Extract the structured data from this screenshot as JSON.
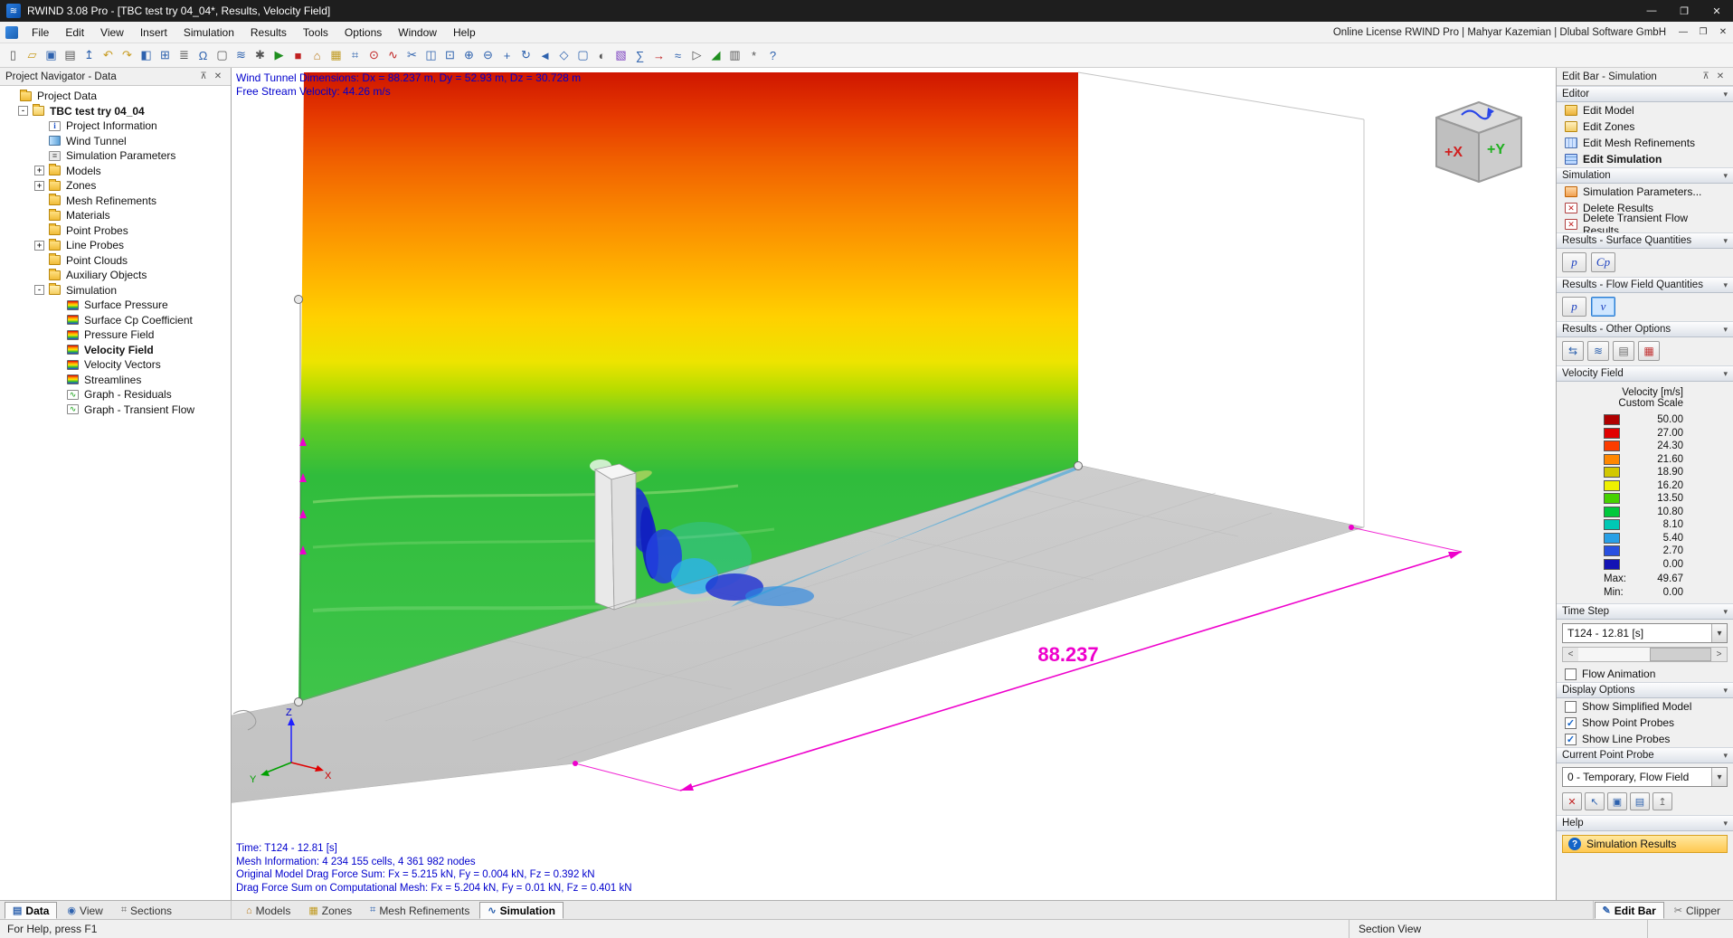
{
  "window": {
    "title": "RWIND 3.08 Pro - [TBC test try 04_04*, Results, Velocity Field]",
    "minimize": "—",
    "maximize": "❐",
    "close": "✕"
  },
  "menubar": {
    "items": [
      "File",
      "Edit",
      "View",
      "Insert",
      "Simulation",
      "Results",
      "Tools",
      "Options",
      "Window",
      "Help"
    ],
    "license": "Online License RWIND Pro | Mahyar Kazemian | Dlubal Software GmbH",
    "mdi": {
      "minimize": "—",
      "restore": "❐",
      "close": "✕"
    }
  },
  "toolbar": {
    "icons": [
      {
        "name": "new-file-icon",
        "g": "▯",
        "c": "#555555"
      },
      {
        "name": "open-icon",
        "g": "▱",
        "c": "#c79a1e"
      },
      {
        "name": "save-icon",
        "g": "▣",
        "c": "#2e62ae"
      },
      {
        "name": "print-icon",
        "g": "▤",
        "c": "#555555"
      },
      {
        "name": "export-icon",
        "g": "↥",
        "c": "#2e62ae"
      },
      {
        "name": "undo-icon",
        "g": "↶",
        "c": "#c79a1e"
      },
      {
        "name": "redo-icon",
        "g": "↷",
        "c": "#c79a1e"
      },
      {
        "name": "navigator-icon",
        "g": "◧",
        "c": "#2e62ae"
      },
      {
        "name": "tables-icon",
        "g": "⊞",
        "c": "#2e62ae"
      },
      {
        "name": "properties-icon",
        "g": "≣",
        "c": "#555555"
      },
      {
        "name": "units-icon",
        "g": "Ω",
        "c": "#2e62ae"
      },
      {
        "name": "comment-icon",
        "g": "▢",
        "c": "#555555"
      },
      {
        "name": "wind-tunnel-icon",
        "g": "≋",
        "c": "#2e62ae"
      },
      {
        "name": "simulation-parameters-icon",
        "g": "✱",
        "c": "#555555"
      },
      {
        "name": "start-simulation-icon",
        "g": "▶",
        "c": "#1f8f1f"
      },
      {
        "name": "stop-simulation-icon",
        "g": "■",
        "c": "#c02020"
      },
      {
        "name": "models-icon",
        "g": "⌂",
        "c": "#b87818"
      },
      {
        "name": "zones-icon",
        "g": "▦",
        "c": "#c09a20"
      },
      {
        "name": "mesh-icon",
        "g": "⌗",
        "c": "#2e62ae"
      },
      {
        "name": "point-probe-icon",
        "g": "⊙",
        "c": "#c02020"
      },
      {
        "name": "line-probe-icon",
        "g": "∿",
        "c": "#c02020"
      },
      {
        "name": "clipper-icon",
        "g": "✂",
        "c": "#2e62ae"
      },
      {
        "name": "section-icon",
        "g": "◫",
        "c": "#2e62ae"
      },
      {
        "name": "zoom-window-icon",
        "g": "⊡",
        "c": "#2e62ae"
      },
      {
        "name": "zoom-in-icon",
        "g": "⊕",
        "c": "#2e62ae"
      },
      {
        "name": "zoom-out-icon",
        "g": "⊖",
        "c": "#2e62ae"
      },
      {
        "name": "pan-icon",
        "g": "+",
        "c": "#2e62ae"
      },
      {
        "name": "rotate-view-icon",
        "g": "↻",
        "c": "#2e62ae"
      },
      {
        "name": "previous-view-icon",
        "g": "◄",
        "c": "#2e62ae"
      },
      {
        "name": "isometric-view-icon",
        "g": "◇",
        "c": "#2e62ae"
      },
      {
        "name": "views-icon",
        "g": "▢",
        "c": "#2e62ae"
      },
      {
        "name": "render-mode-icon",
        "g": "◐",
        "c": "#555555"
      },
      {
        "name": "color-scale-icon",
        "g": "▧",
        "c": "#7a3fbf"
      },
      {
        "name": "result-values-icon",
        "g": "∑",
        "c": "#2e62ae"
      },
      {
        "name": "vectors-icon",
        "g": "→",
        "c": "#c02020"
      },
      {
        "name": "streamlines-icon",
        "g": "≈",
        "c": "#2e62ae"
      },
      {
        "name": "animation-icon",
        "g": "▷",
        "c": "#555555"
      },
      {
        "name": "graph-icon",
        "g": "◢",
        "c": "#1f8f1f"
      },
      {
        "name": "report-icon",
        "g": "▥",
        "c": "#555555"
      },
      {
        "name": "settings-icon",
        "g": "*",
        "c": "#555555"
      },
      {
        "name": "help-icon",
        "g": "?",
        "c": "#2e62ae"
      }
    ]
  },
  "navigator": {
    "title": "Project Navigator - Data",
    "pin": "⊼",
    "close": "✕",
    "items": [
      {
        "label": "Project Data",
        "lvl": 0,
        "icon": "folder",
        "exp": "",
        "st": ""
      },
      {
        "label": "TBC test try 04_04",
        "lvl": 1,
        "icon": "folder-open",
        "exp": "-",
        "st": "bold"
      },
      {
        "label": "Project Information",
        "lvl": 2,
        "icon": "doc",
        "exp": "",
        "st": ""
      },
      {
        "label": "Wind Tunnel",
        "lvl": 2,
        "icon": "tunnel",
        "exp": "",
        "st": ""
      },
      {
        "label": "Simulation Parameters",
        "lvl": 2,
        "icon": "params",
        "exp": "",
        "st": ""
      },
      {
        "label": "Models",
        "lvl": 2,
        "icon": "folder",
        "exp": "+",
        "st": ""
      },
      {
        "label": "Zones",
        "lvl": 2,
        "icon": "folder",
        "exp": "+",
        "st": ""
      },
      {
        "label": "Mesh Refinements",
        "lvl": 2,
        "icon": "folder",
        "exp": "",
        "st": ""
      },
      {
        "label": "Materials",
        "lvl": 2,
        "icon": "folder",
        "exp": "",
        "st": ""
      },
      {
        "label": "Point Probes",
        "lvl": 2,
        "icon": "folder",
        "exp": "",
        "st": ""
      },
      {
        "label": "Line Probes",
        "lvl": 2,
        "icon": "folder",
        "exp": "+",
        "st": ""
      },
      {
        "label": "Point Clouds",
        "lvl": 2,
        "icon": "folder",
        "exp": "",
        "st": ""
      },
      {
        "label": "Auxiliary Objects",
        "lvl": 2,
        "icon": "folder",
        "exp": "",
        "st": ""
      },
      {
        "label": "Simulation",
        "lvl": 2,
        "icon": "folder-open",
        "exp": "-",
        "st": ""
      },
      {
        "label": "Surface Pressure",
        "lvl": 3,
        "icon": "result",
        "exp": "",
        "st": ""
      },
      {
        "label": "Surface Cp Coefficient",
        "lvl": 3,
        "icon": "result",
        "exp": "",
        "st": ""
      },
      {
        "label": "Pressure Field",
        "lvl": 3,
        "icon": "result",
        "exp": "",
        "st": ""
      },
      {
        "label": "Velocity Field",
        "lvl": 3,
        "icon": "result",
        "exp": "",
        "st": "bold"
      },
      {
        "label": "Velocity Vectors",
        "lvl": 3,
        "icon": "result",
        "exp": "",
        "st": ""
      },
      {
        "label": "Streamlines",
        "lvl": 3,
        "icon": "result",
        "exp": "",
        "st": ""
      },
      {
        "label": "Graph - Residuals",
        "lvl": 3,
        "icon": "graph",
        "exp": "",
        "st": ""
      },
      {
        "label": "Graph - Transient Flow",
        "lvl": 3,
        "icon": "graph",
        "exp": "",
        "st": ""
      }
    ]
  },
  "viewport": {
    "info_top": [
      "Wind Tunnel Dimensions: Dx = 88.237 m, Dy = 52.93 m, Dz = 30.728 m",
      "Free Stream Velocity: 44.26 m/s"
    ],
    "info_bottom": [
      "Time: T124 - 12.81 [s]",
      "Mesh Information: 4 234 155 cells, 4 361 982 nodes",
      "Original Model Drag Force Sum: Fx = 5.215 kN, Fy = 0.004 kN, Fz = 0.392 kN",
      "Drag Force Sum on Computational Mesh: Fx = 5.204 kN, Fy = 0.01 kN, Fz = 0.401 kN"
    ],
    "dimension_label": "88.237",
    "nav_cube": {
      "x": "+X",
      "y": "+Y"
    },
    "axes": {
      "x": "X",
      "y": "Y",
      "z": "Z"
    }
  },
  "editbar": {
    "title": "Edit Bar - Simulation",
    "pin": "⊼",
    "close": "✕",
    "collapse": "▾",
    "dropdown": "▾",
    "editor": {
      "header": "Editor",
      "items": [
        {
          "label": "Edit Model",
          "icon": "edit-model",
          "st": ""
        },
        {
          "label": "Edit Zones",
          "icon": "edit-zones",
          "st": ""
        },
        {
          "label": "Edit Mesh Refinements",
          "icon": "edit-mesh",
          "st": ""
        },
        {
          "label": "Edit Simulation",
          "icon": "edit-simulation",
          "st": "bold"
        }
      ]
    },
    "simulation": {
      "header": "Simulation",
      "items": [
        {
          "label": "Simulation Parameters...",
          "icon": "sim-params",
          "st": ""
        },
        {
          "label": "Delete Results",
          "icon": "delete-results",
          "st": ""
        },
        {
          "label": "Delete Transient Flow Results...",
          "icon": "delete-transient",
          "st": ""
        }
      ]
    },
    "surface_quantities": {
      "header": "Results - Surface Quantities",
      "buttons": [
        {
          "label": "p",
          "on": false
        },
        {
          "label": "Cp",
          "on": false
        }
      ]
    },
    "flow_quantities": {
      "header": "Results - Flow Field Quantities",
      "buttons": [
        {
          "label": "p",
          "on": false
        },
        {
          "label": "v",
          "on": true
        }
      ]
    },
    "other_options": {
      "header": "Results - Other Options",
      "buttons": [
        {
          "name": "transfer-results-icon",
          "g": "⇆",
          "c": "#2e62ae"
        },
        {
          "name": "layers-icon",
          "g": "≋",
          "c": "#2e62ae"
        },
        {
          "name": "legend-options-icon",
          "g": "▤",
          "c": "#6a6a6a"
        },
        {
          "name": "result-table-icon",
          "g": "▦",
          "c": "#c03030"
        }
      ]
    },
    "velocity_field": {
      "header": "Velocity Field",
      "unit": "Velocity [m/s]",
      "scale": "Custom Scale",
      "legend": [
        {
          "v": "50.00",
          "color": "#b00000"
        },
        {
          "v": "27.00",
          "color": "#e10000"
        },
        {
          "v": "24.30",
          "color": "#fb3c00"
        },
        {
          "v": "21.60",
          "color": "#ff8700"
        },
        {
          "v": "18.90",
          "color": "#d2c800"
        },
        {
          "v": "16.20",
          "color": "#eef000"
        },
        {
          "v": "13.50",
          "color": "#46d200"
        },
        {
          "v": "10.80",
          "color": "#00c83c"
        },
        {
          "v": "8.10",
          "color": "#00c8b4"
        },
        {
          "v": "5.40",
          "color": "#28a0e6"
        },
        {
          "v": "2.70",
          "color": "#2850e0"
        },
        {
          "v": "0.00",
          "color": "#1414b4"
        }
      ],
      "max_label": "Max:",
      "max": "49.67",
      "min_label": "Min:",
      "min": "0.00"
    },
    "time_step": {
      "header": "Time Step",
      "value": "T124 - 12.81 [s]",
      "prev": "<",
      "next": ">",
      "animation_label": "Flow Animation",
      "animation_on": false
    },
    "display_options": {
      "header": "Display Options",
      "options": [
        {
          "label": "Show Simplified Model",
          "on": false
        },
        {
          "label": "Show Point Probes",
          "on": true
        },
        {
          "label": "Show Line Probes",
          "on": true
        }
      ]
    },
    "current_point_probe": {
      "header": "Current Point Probe",
      "value": "0 - Temporary, Flow Field",
      "buttons": [
        {
          "name": "delete-probe-icon",
          "g": "✕",
          "c": "#c02020"
        },
        {
          "name": "pick-probe-icon",
          "g": "↖",
          "c": "#2e62ae"
        },
        {
          "name": "save-probe-icon",
          "g": "▣",
          "c": "#2e62ae"
        },
        {
          "name": "probe-table-icon",
          "g": "▤",
          "c": "#2e62ae"
        },
        {
          "name": "probe-export-icon",
          "g": "↥",
          "c": "#6a6a6a"
        }
      ]
    },
    "help": {
      "header": "Help",
      "icon_glyph": "?",
      "link": "Simulation Results"
    }
  },
  "tabs": {
    "left": [
      {
        "label": "Data",
        "g": "▤",
        "c": "#2e62ae",
        "on": true
      },
      {
        "label": "View",
        "g": "◉",
        "c": "#2e62ae",
        "on": false
      },
      {
        "label": "Sections",
        "g": "⌗",
        "c": "#6a6a6a",
        "on": false
      }
    ],
    "center": [
      {
        "label": "Models",
        "g": "⌂",
        "c": "#b87818",
        "on": false
      },
      {
        "label": "Zones",
        "g": "▦",
        "c": "#c09a20",
        "on": false
      },
      {
        "label": "Mesh Refinements",
        "g": "⌗",
        "c": "#2e62ae",
        "on": false
      },
      {
        "label": "Simulation",
        "g": "∿",
        "c": "#2e62ae",
        "on": true
      }
    ],
    "right": [
      {
        "label": "Edit Bar",
        "g": "✎",
        "c": "#2e62ae",
        "on": true
      },
      {
        "label": "Clipper",
        "g": "✂",
        "c": "#6a6a6a",
        "on": false
      }
    ]
  },
  "statusbar": {
    "left": "For Help, press F1",
    "view": "Section View"
  }
}
